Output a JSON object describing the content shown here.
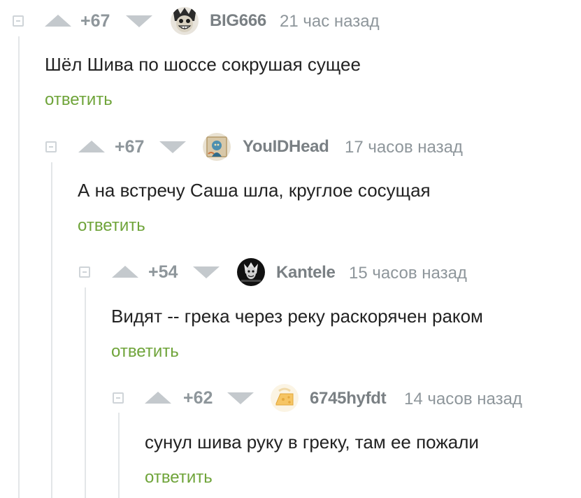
{
  "colors": {
    "reply": "#6fa43a",
    "muted": "#8e969b",
    "text": "#222222",
    "vote_arrow": "#c4c9cd"
  },
  "comments": [
    {
      "rating": "+67",
      "username": "BIG666",
      "time": "21 час назад",
      "text": "Шёл Шива по шоссе сокрушая сущее",
      "reply": "ответить",
      "avatar_icon": "grinning-face-avatar-icon"
    },
    {
      "rating": "+67",
      "username": "YouIDHead",
      "time": "17 часов назад",
      "text": "А на встречу Саша шла, круглое сосущая",
      "reply": "ответить",
      "avatar_icon": "painting-avatar-icon"
    },
    {
      "rating": "+54",
      "username": "Kantele",
      "time": "15 часов назад",
      "text": "Видят -- грека через реку раскорячен раком",
      "reply": "ответить",
      "avatar_icon": "dark-figure-avatar-icon"
    },
    {
      "rating": "+62",
      "username": "6745hyfdt",
      "time": "14 часов назад",
      "text": "сунул шива руку в греку, там ее пожали",
      "reply": "ответить",
      "avatar_icon": "cheese-avatar-icon"
    }
  ]
}
